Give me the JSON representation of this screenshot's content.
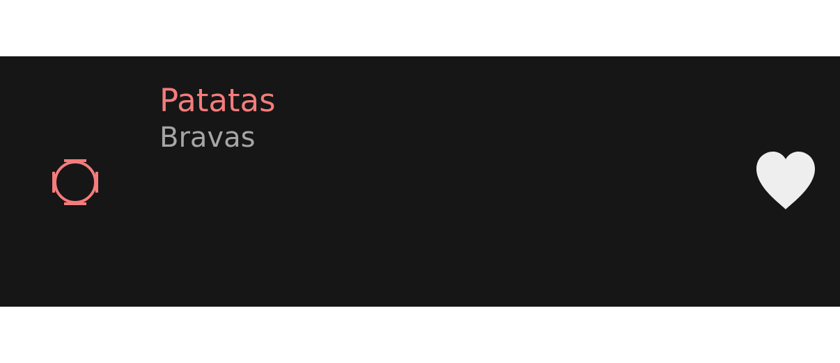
{
  "item": {
    "title": "Patatas",
    "subtitle": "Bravas",
    "leading_icon": "circle-outline-icon",
    "trailing_icon": "heart-icon"
  },
  "colors": {
    "background": "#161616",
    "title": "#f47c7c",
    "subtitle": "#a6a6a6",
    "heart": "#eeeeee",
    "leading_icon": "#f47c7c"
  }
}
